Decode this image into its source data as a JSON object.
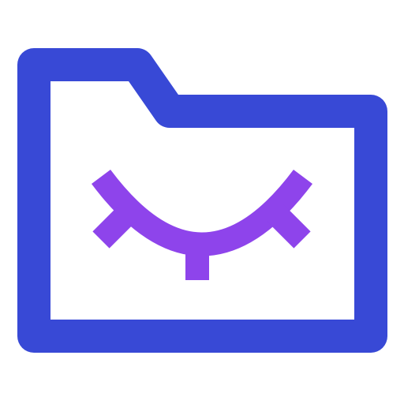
{
  "icon": {
    "name": "hidden-folder-icon",
    "parts": [
      "folder-icon",
      "closed-eye-icon"
    ],
    "colors": {
      "folder_stroke": "#3849D6",
      "eye_stroke": "#8E44EB",
      "background": "#FFFFFF"
    }
  }
}
